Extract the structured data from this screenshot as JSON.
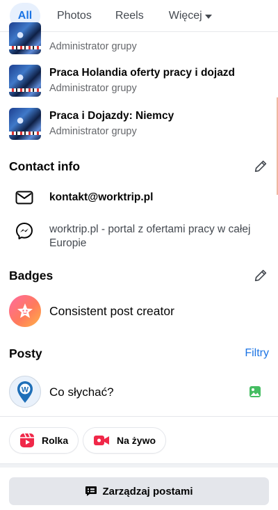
{
  "tabs": [
    {
      "label": "All",
      "active": true
    },
    {
      "label": "Photos",
      "active": false
    },
    {
      "label": "Reels",
      "active": false
    },
    {
      "label": "Więcej",
      "active": false
    }
  ],
  "groups": [
    {
      "title": "",
      "subtitle": "Administrator grupy"
    },
    {
      "title": "Praca Holandia oferty pracy i dojazd",
      "subtitle": "Administrator grupy"
    },
    {
      "title": "Praca i Dojazdy: Niemcy",
      "subtitle": "Administrator grupy"
    }
  ],
  "contact": {
    "title": "Contact info",
    "email": "kontakt@worktrip.pl",
    "messenger_line1": "worktrip.pl - portal z ofertami pracy w całej",
    "messenger_line2": "Europie"
  },
  "badges": {
    "title": "Badges",
    "item": "Consistent post creator"
  },
  "posts": {
    "title": "Posty",
    "filter_label": "Filtry",
    "composer_placeholder": "Co słychać?",
    "reel_label": "Rolka",
    "live_label": "Na żywo",
    "manage_label": "Zarządzaj postami"
  },
  "colors": {
    "accent": "#1b74e4",
    "reel_red": "#f02849",
    "photo_green": "#45bd62"
  },
  "icons": [
    "caret-down-icon",
    "pencil-icon",
    "mail-icon",
    "messenger-icon",
    "star-badge-icon",
    "photo-icon",
    "reel-icon",
    "live-video-icon",
    "manage-posts-icon"
  ]
}
